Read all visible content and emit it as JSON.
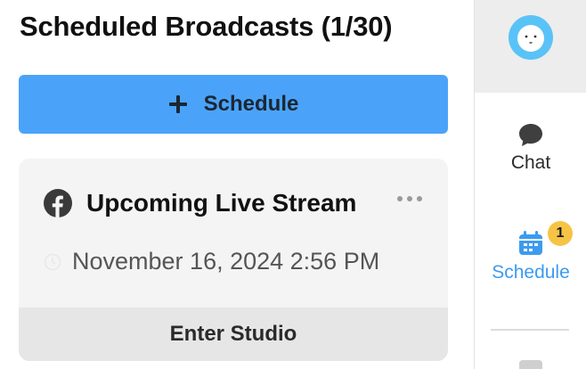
{
  "header": {
    "title": "Scheduled Broadcasts (1/30)"
  },
  "toolbar": {
    "schedule_label": "Schedule"
  },
  "broadcasts": [
    {
      "platform_icon": "facebook-icon",
      "title": "Upcoming Live Stream",
      "datetime": "November 16, 2024 2:56 PM",
      "action_label": "Enter Studio"
    }
  ],
  "sidebar": {
    "items": [
      {
        "label": "Chat",
        "icon": "chat-icon",
        "active": false
      },
      {
        "label": "Schedule",
        "icon": "calendar-icon",
        "active": true,
        "badge": "1"
      }
    ]
  },
  "colors": {
    "accent": "#4ba3f9",
    "active_nav": "#3c9bf0",
    "badge": "#f6c445",
    "avatar": "#59c3f7",
    "card_bg": "#f4f4f4"
  }
}
